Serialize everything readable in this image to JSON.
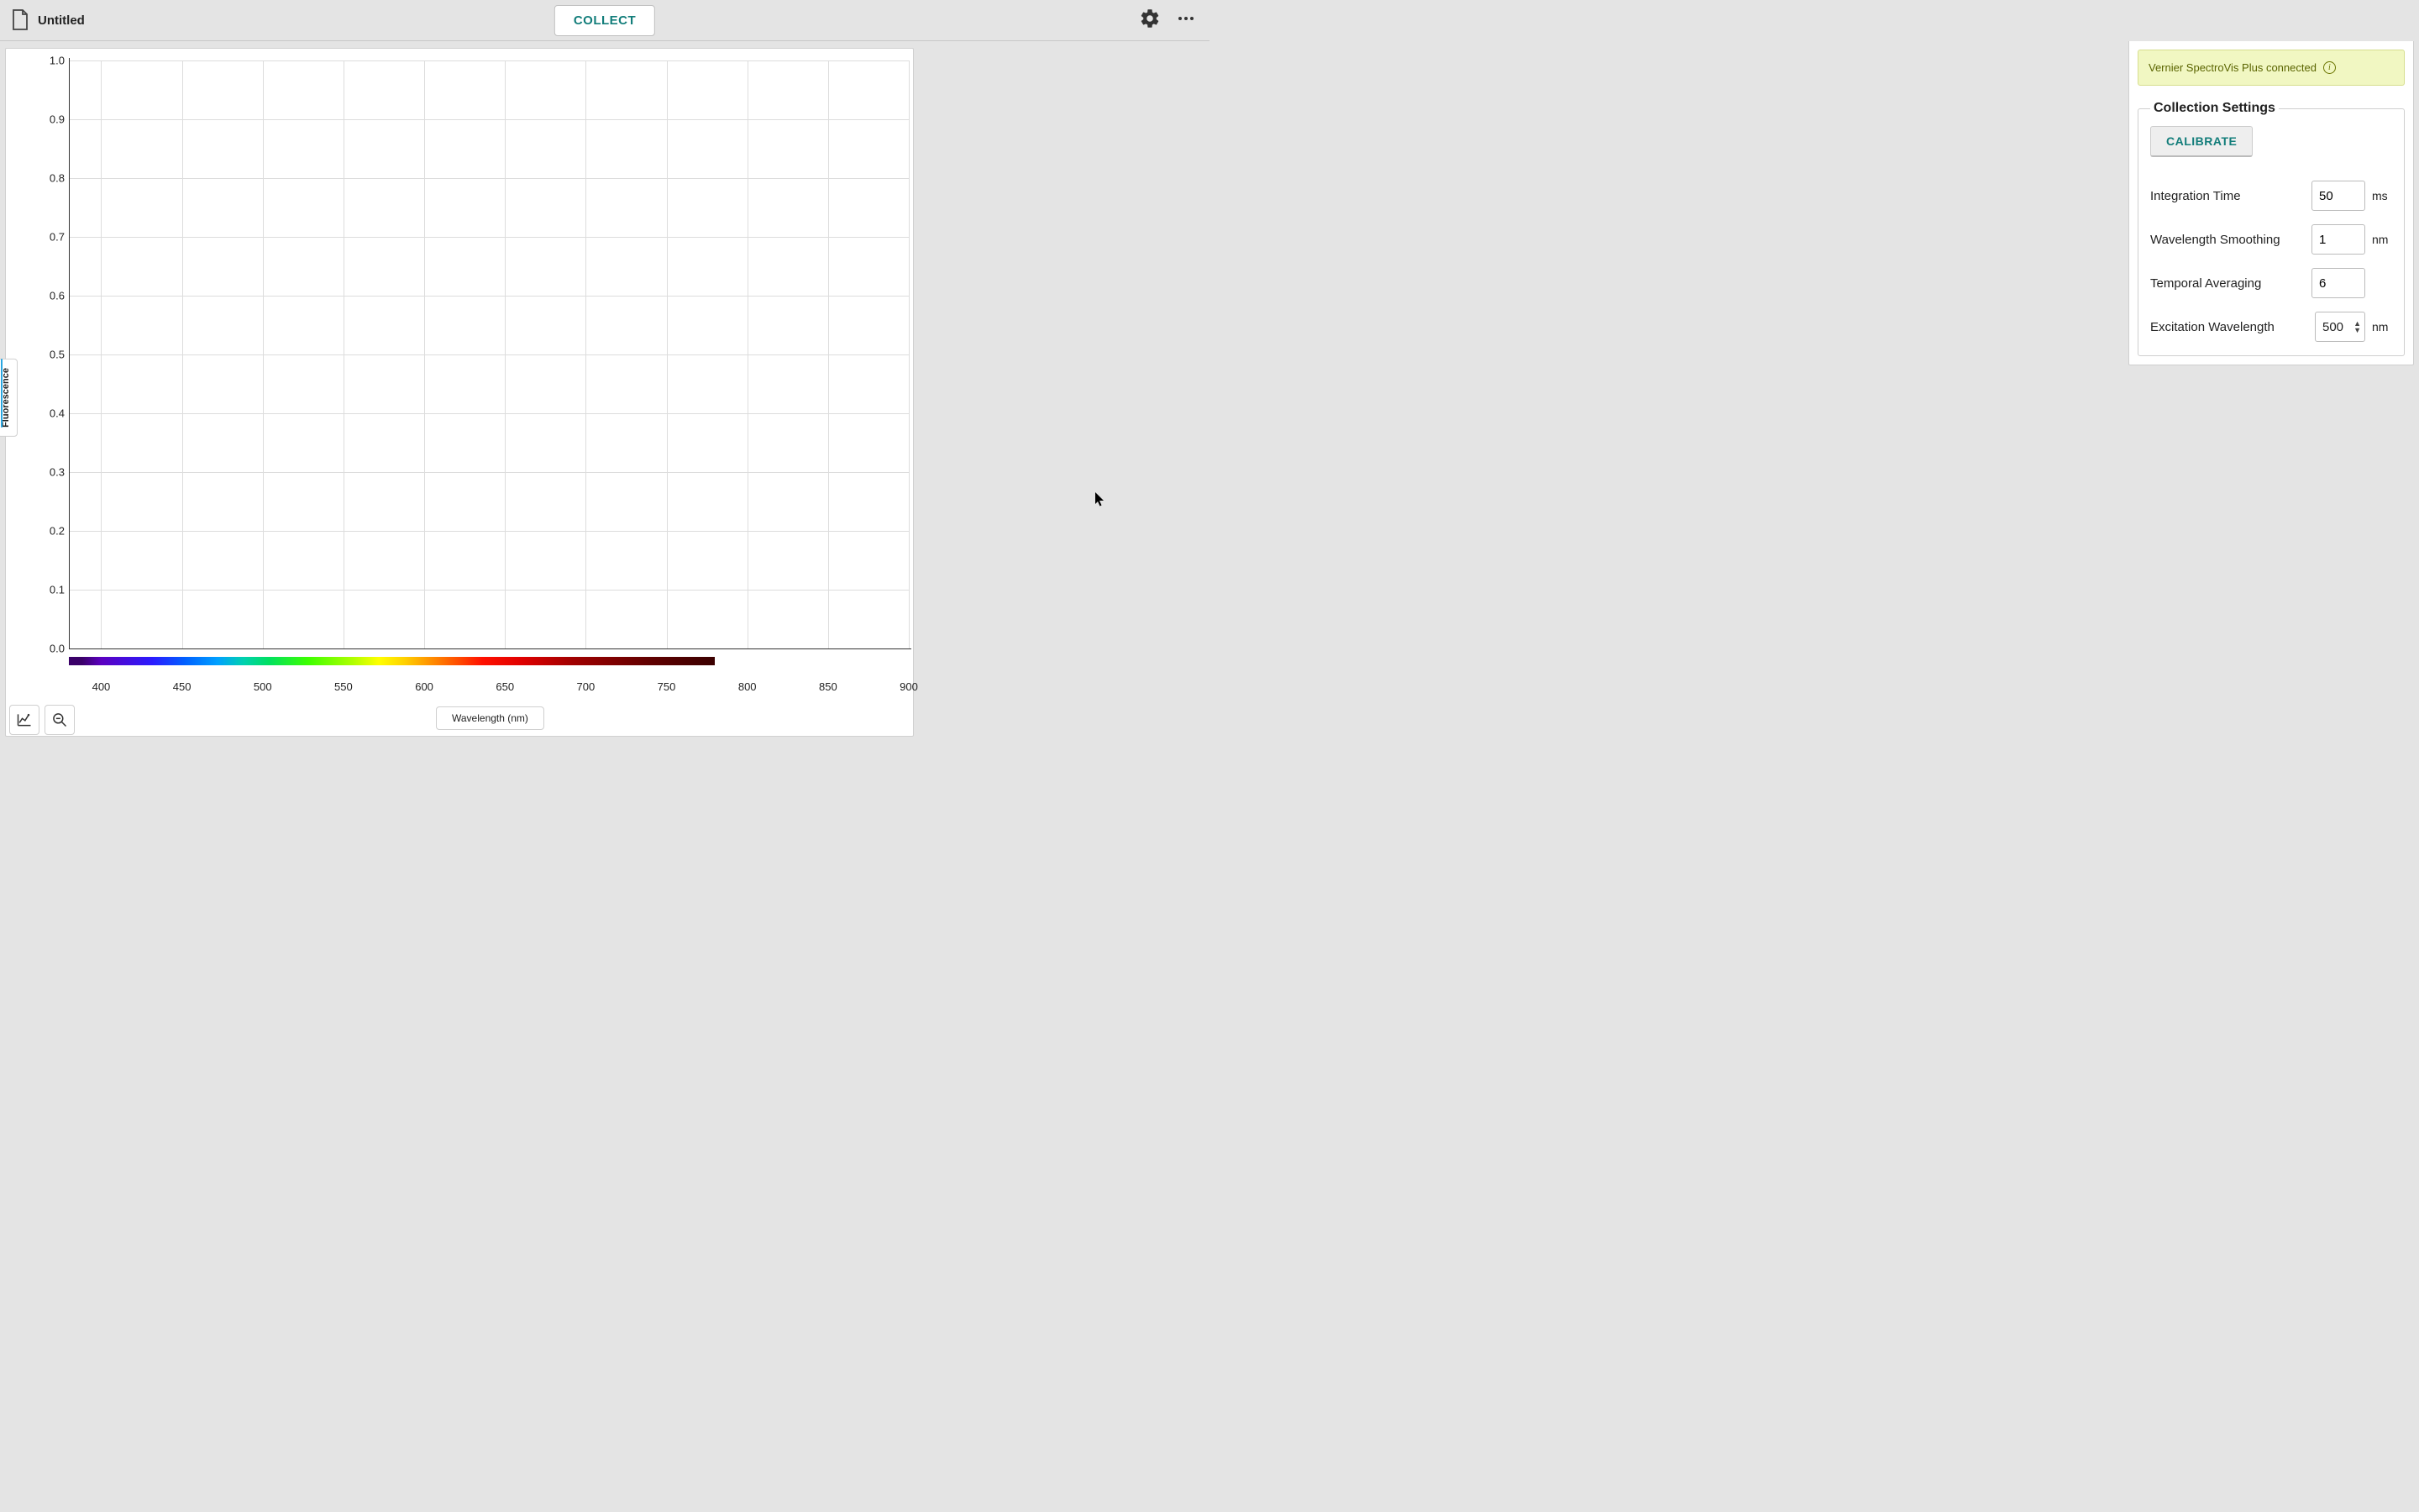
{
  "toolbar": {
    "title": "Untitled",
    "collect_label": "COLLECT"
  },
  "chart_data": {
    "type": "line",
    "title": "",
    "xlabel": "Wavelength (nm)",
    "ylabel": "Fluorescence",
    "xlim": [
      380,
      900
    ],
    "ylim": [
      0.0,
      1.0
    ],
    "xticks": [
      400,
      450,
      500,
      550,
      600,
      650,
      700,
      750,
      800,
      850,
      900
    ],
    "yticks": [
      0.0,
      0.1,
      0.2,
      0.3,
      0.4,
      0.5,
      0.6,
      0.7,
      0.8,
      0.9,
      1.0
    ],
    "series": [],
    "spectrum_visible_range_nm": [
      380,
      780
    ]
  },
  "yticks_fmt": [
    "0.0",
    "0.1",
    "0.2",
    "0.3",
    "0.4",
    "0.5",
    "0.6",
    "0.7",
    "0.8",
    "0.9",
    "1.0"
  ],
  "xticks_fmt": [
    "400",
    "450",
    "500",
    "550",
    "600",
    "650",
    "700",
    "750",
    "800",
    "850",
    "900"
  ],
  "sidebar": {
    "status_text": "Vernier SpectroVis Plus connected",
    "panel_title": "Collection Settings",
    "calibrate_label": "CALIBRATE",
    "fields": {
      "integration_time": {
        "label": "Integration Time",
        "value": "50",
        "unit": "ms"
      },
      "wavelength_smoothing": {
        "label": "Wavelength Smoothing",
        "value": "1",
        "unit": "nm"
      },
      "temporal_averaging": {
        "label": "Temporal Averaging",
        "value": "6",
        "unit": ""
      },
      "excitation_wavelength": {
        "label": "Excitation Wavelength",
        "value": "500",
        "unit": "nm"
      }
    }
  },
  "colors": {
    "accent": "#127d7a",
    "axis_highlight": "#2aa6e0",
    "status_bg": "#f1f7c2"
  }
}
